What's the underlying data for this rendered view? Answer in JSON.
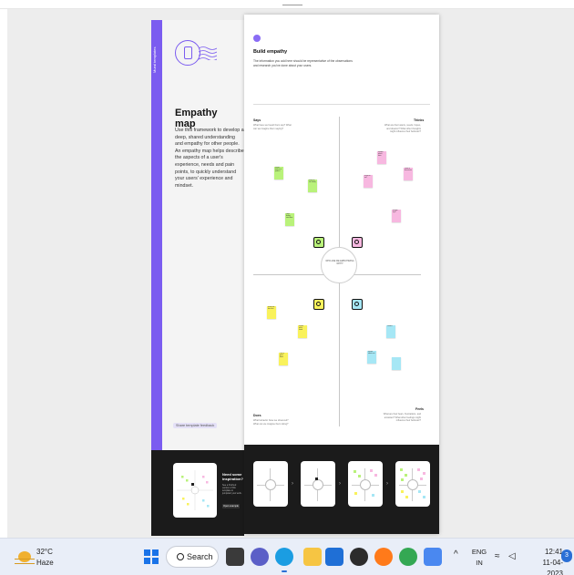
{
  "left_panel": {
    "brand": "Mural templates",
    "title": "Empathy map",
    "description": "Use this framework to develop a deep, shared understanding and empathy for other people. An empathy map helps describe the aspects of a user's experience, needs and pain points, to quickly understand your users' experience and mindset.",
    "feedback_link": "Share template feedback",
    "inspiration": {
      "title": "Need some inspiration?",
      "body": "See a finished version of this template to jumpstart your work.",
      "link": "Open example"
    }
  },
  "board": {
    "title": "Build empathy",
    "subtitle": "The information you add here should be representative of the observations and research you've done about your users.",
    "center_label": "WHO ARE WE EMPATHIZING WITH?",
    "quadrants": {
      "says": {
        "title": "Says",
        "question": "What have we heard them say? What can we imagine them saying?"
      },
      "thinks": {
        "title": "Thinks",
        "question": "What are their wants, needs, hopes, and dreams? What other thoughts might influence their behavior?"
      },
      "does": {
        "title": "Does",
        "question": "What behavior have we observed? What can we imagine them doing?"
      },
      "feels": {
        "title": "Feels",
        "question": "What are their fears, frustrations, and anxieties? What other feelings might influence their behavior?"
      }
    },
    "sticky_notes": [
      {
        "text": "Would work on a product",
        "color": "#b9f27a"
      },
      {
        "text": "Wants to use it daily",
        "color": "#b9f27a"
      },
      {
        "text": "Likes finding new ideas",
        "color": "#b9f27a"
      },
      {
        "text": "Wonder what it does",
        "color": "#f7b8e0"
      },
      {
        "text": "Is this for me?",
        "color": "#f7b8e0"
      },
      {
        "text": "I want to know more",
        "color": "#f7b8e0"
      },
      {
        "text": "Should I try it?",
        "color": "#f7b8e0"
      },
      {
        "text": "Reads the docs first",
        "color": "#f9f25c"
      },
      {
        "text": "Shares with a friend",
        "color": "#f9f25c"
      },
      {
        "text": "Tries a quick demo",
        "color": "#f9f25c"
      },
      {
        "text": "Curious",
        "color": "#a6e7f5"
      },
      {
        "text": "Unsure about cost",
        "color": "#a6e7f5"
      },
      {
        "text": "",
        "color": "#a6e7f5"
      }
    ],
    "icons": [
      "speech-bubble-icon",
      "thought-bubble-icon",
      "hand-icon",
      "heart-icon"
    ]
  },
  "template_thumbnails": [
    "empathy-map-blank",
    "empathy-map-center",
    "empathy-map-partial",
    "empathy-map-complete"
  ],
  "taskbar": {
    "temperature": "32°C",
    "condition": "Haze",
    "search_label": "Search",
    "lang_top": "ENG",
    "lang_bottom": "IN",
    "time": "12:41",
    "date": "11-04-2023",
    "notification_count": "3",
    "apps": [
      {
        "name": "file-explorer",
        "color": "#f6c543"
      },
      {
        "name": "microsoft-store",
        "color": "#1f6fd6"
      },
      {
        "name": "dell",
        "color": "#2c2c2c"
      },
      {
        "name": "firefox",
        "color": "#ff7a1a"
      },
      {
        "name": "chrome",
        "color": "#34a853"
      },
      {
        "name": "docs",
        "color": "#4a88f0"
      }
    ]
  }
}
